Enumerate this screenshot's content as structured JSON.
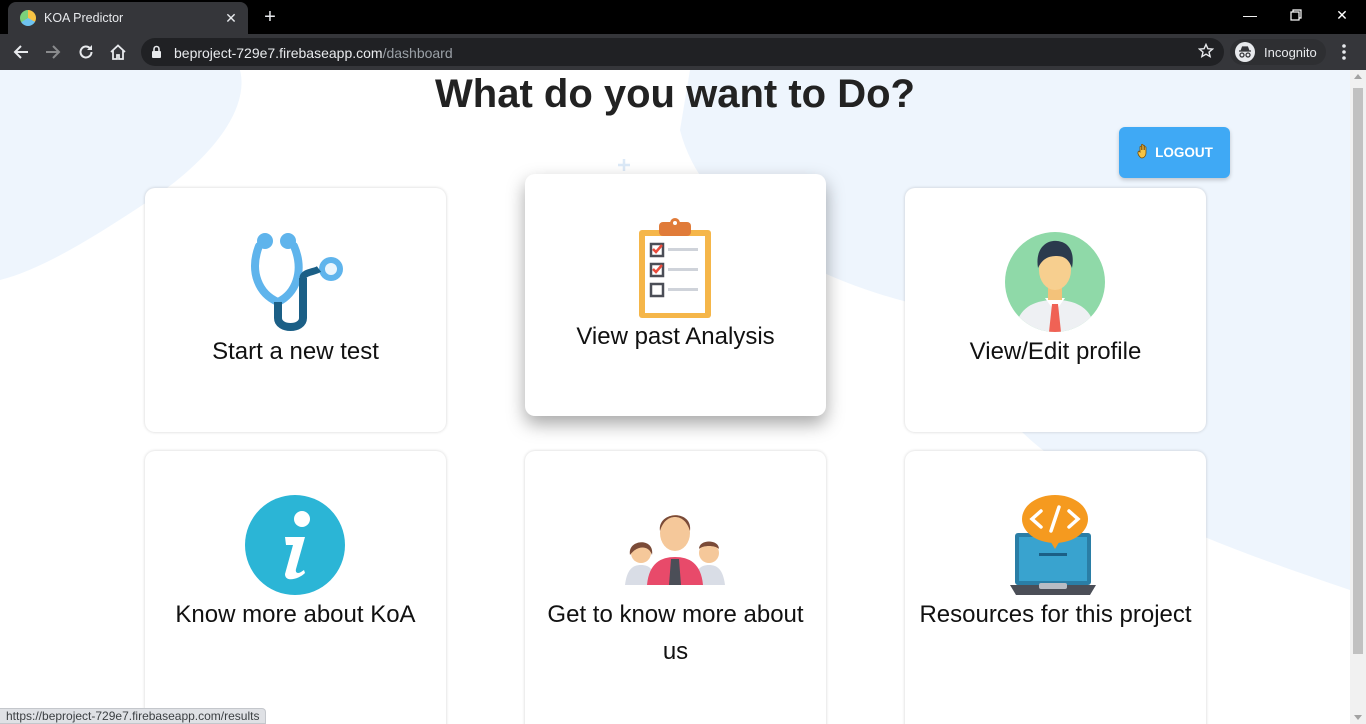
{
  "browser": {
    "tab_title": "KOA Predictor",
    "url_host": "beproject-729e7.firebaseapp.com",
    "url_path": "/dashboard",
    "incognito_label": "Incognito",
    "status_url": "https://beproject-729e7.firebaseapp.com/results"
  },
  "page": {
    "heading": "What do you want to Do?",
    "logout_label": "LOGOUT",
    "cards": [
      {
        "label": "Start a new test",
        "icon": "stethoscope-icon"
      },
      {
        "label": "View past Analysis",
        "icon": "clipboard-checklist-icon"
      },
      {
        "label": "View/Edit profile",
        "icon": "user-avatar-icon"
      },
      {
        "label": "Know more about KoA",
        "icon": "info-icon"
      },
      {
        "label": "Get to know more about us",
        "icon": "team-icon"
      },
      {
        "label": "Resources for this project",
        "icon": "code-laptop-icon"
      }
    ]
  },
  "colors": {
    "accent": "#3fa9f5",
    "background_blob": "#eef5fd"
  }
}
